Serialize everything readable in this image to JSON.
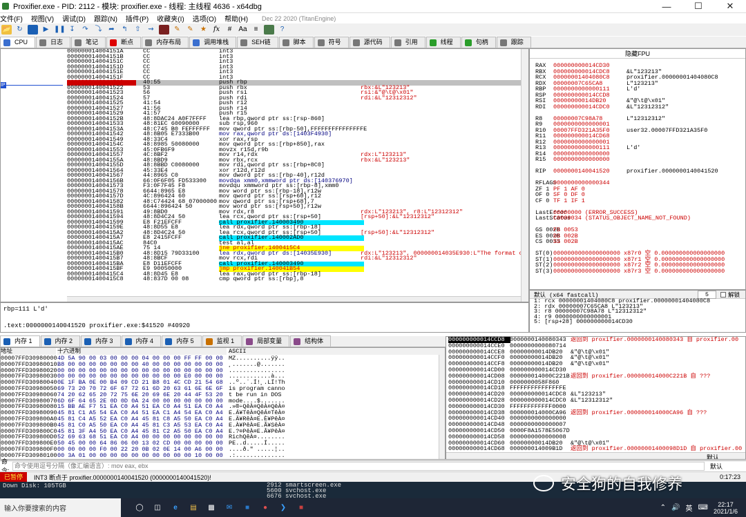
{
  "window": {
    "title": "Proxifier.exe - PID: 2112 - 模块: proxifier.exe - 线程: 主线程 4636 - x64dbg"
  },
  "menu": {
    "items": [
      "文件(F)",
      "视图(V)",
      "调试(D)",
      "跟踪(N)",
      "插件(P)",
      "收藏夹(I)",
      "选项(O)",
      "帮助(H)"
    ],
    "date": "Dec 22 2020 (TitanEngine)"
  },
  "toolbar": {
    "icons": [
      "open-icon",
      "restart-icon",
      "stop-icon",
      "run-icon",
      "pause-icon",
      "step-into-icon",
      "step-over-icon",
      "trace-into-icon",
      "trace-over-icon",
      "execute-till-return-icon",
      "run-to-user-code-icon",
      "scylla-icon",
      "patch-icon",
      "comment-icon",
      "label-icon",
      "bookmark-icon",
      "function-icon",
      "hash-icon",
      "font-icon",
      "strings-icon",
      "calculator-icon",
      "help-icon"
    ]
  },
  "tabs": [
    {
      "label": "CPU",
      "color": "#3a6fcf",
      "active": true
    },
    {
      "label": "日志",
      "color": "#777"
    },
    {
      "label": "笔记",
      "color": "#777"
    },
    {
      "label": "断点",
      "color": "#d00"
    },
    {
      "label": "内存布局",
      "color": "#777"
    },
    {
      "label": "调用堆栈",
      "color": "#3a6fcf"
    },
    {
      "label": "SEH链",
      "color": "#777"
    },
    {
      "label": "脚本",
      "color": "#777"
    },
    {
      "label": "符号",
      "color": "#777"
    },
    {
      "label": "源代码",
      "color": "#777"
    },
    {
      "label": "引用",
      "color": "#777"
    },
    {
      "label": "线程",
      "color": "#2a9d2a"
    },
    {
      "label": "句柄",
      "color": "#2a9d2a"
    },
    {
      "label": "跟踪",
      "color": "#777"
    }
  ],
  "disasm": [
    {
      "addr": "000000014004151A",
      "bytes": "CC",
      "asm": "int3",
      "cmt": ""
    },
    {
      "addr": "000000014004151B",
      "bytes": "CC",
      "asm": "int3",
      "cmt": ""
    },
    {
      "addr": "000000014004151C",
      "bytes": "CC",
      "asm": "int3",
      "cmt": ""
    },
    {
      "addr": "000000014004151D",
      "bytes": "CC",
      "asm": "int3",
      "cmt": ""
    },
    {
      "addr": "000000014004151E",
      "bytes": "CC",
      "asm": "int3",
      "cmt": ""
    },
    {
      "addr": "000000014004151F",
      "bytes": "CC",
      "asm": "int3",
      "cmt": ""
    },
    {
      "addr": "0000000140041520",
      "bytes": "40:55",
      "asm": "push rbp",
      "cmt": "",
      "sel": true
    },
    {
      "addr": "0000000140041522",
      "bytes": "53",
      "asm": "push rbx",
      "cmt": "rbx:&L\"123213\""
    },
    {
      "addr": "0000000140041523",
      "bytes": "56",
      "asm": "push rsi",
      "cmt": "rsi:&\"@\\t@\\x01\""
    },
    {
      "addr": "0000000140041524",
      "bytes": "57",
      "asm": "push rdi",
      "cmt": "rdi:&L\"12312312\""
    },
    {
      "addr": "0000000140041525",
      "bytes": "41:54",
      "asm": "push r12",
      "cmt": ""
    },
    {
      "addr": "0000000140041527",
      "bytes": "41:56",
      "asm": "push r14",
      "cmt": ""
    },
    {
      "addr": "0000000140041529",
      "bytes": "41:57",
      "asm": "push r15",
      "cmt": ""
    },
    {
      "addr": "000000014004152B",
      "bytes": "48:8DAC24 A0F7FFFF",
      "asm": "lea rbp,qword ptr ss:[rsp-860]",
      "cmt": ""
    },
    {
      "addr": "0000000140041533",
      "bytes": "48:81EC 60090000",
      "asm": "sub rsp,960",
      "cmt": ""
    },
    {
      "addr": "000000014004153A",
      "bytes": "48:C745 B0 FEFFFFFF",
      "asm": "mov qword ptr ss:[rbp-50],FFFFFFFFFFFFFFFE",
      "cmt": ""
    },
    {
      "addr": "0000000140041542",
      "bytes": "48:8B05 E7333B00",
      "asm": "mov rax,qword ptr ds:[1403F4930]",
      "cmt": "",
      "hl": "1403F4930"
    },
    {
      "addr": "0000000140041549",
      "bytes": "48:33C4",
      "asm": "xor rax,rsp",
      "cmt": ""
    },
    {
      "addr": "000000014004154C",
      "bytes": "48:8985 50080000",
      "asm": "mov qword ptr ss:[rbp+850],rax",
      "cmt": ""
    },
    {
      "addr": "0000000140041553",
      "bytes": "45:0FB6F9",
      "asm": "movzx r15d,r9b",
      "cmt": ""
    },
    {
      "addr": "0000000140041557",
      "bytes": "4C:8BF2",
      "asm": "mov r14,rdx",
      "cmt": "rdx:L\"123213\""
    },
    {
      "addr": "000000014004155A",
      "bytes": "48:8BD9",
      "asm": "mov rbx,rcx",
      "cmt": "rbx:&L\"123213\""
    },
    {
      "addr": "000000014004155D",
      "bytes": "48:8BBD C0080000",
      "asm": "mov rdi,qword ptr ss:[rbp+8C0]",
      "cmt": ""
    },
    {
      "addr": "0000000140041564",
      "bytes": "45:33E4",
      "asm": "xor r12d,r12d",
      "cmt": ""
    },
    {
      "addr": "0000000140041567",
      "bytes": "44:8965 C0",
      "asm": "mov dword ptr ss:[rbp-40],r12d",
      "cmt": ""
    },
    {
      "addr": "000000014004156B",
      "bytes": "66:0F6F05 FD533300",
      "asm": "movdqa xmm0,xmmword ptr ds:[140376970]",
      "cmt": "",
      "hl": "140376970"
    },
    {
      "addr": "0000000140041573",
      "bytes": "F3:0F7F45 F8",
      "asm": "movdqu xmmword ptr ss:[rbp-8],xmm0",
      "cmt": ""
    },
    {
      "addr": "0000000140041578",
      "bytes": "6644:8965 E8",
      "asm": "mov word ptr ss:[rbp-18],r12w",
      "cmt": ""
    },
    {
      "addr": "000000014004157D",
      "bytes": "4C:896424 60",
      "asm": "mov qword ptr ss:[rsp+60],r12",
      "cmt": ""
    },
    {
      "addr": "0000000140041582",
      "bytes": "48:C74424 68 07000000",
      "asm": "mov qword ptr ss:[rsp+68],7",
      "cmt": ""
    },
    {
      "addr": "000000014004158B",
      "bytes": "6644:896424 50",
      "asm": "mov word ptr ss:[rsp+50],r12w",
      "cmt": ""
    },
    {
      "addr": "0000000140041591",
      "bytes": "49:8BD0",
      "asm": "mov rdx,r8",
      "cmt": "rdx:L\"123213\", r8:L\"12312312\""
    },
    {
      "addr": "0000000140041594",
      "bytes": "48:8D4C24 50",
      "asm": "lea rcx,qword ptr ss:[rsp+50]",
      "cmt": "[rsp+50]:&L\"12312312\""
    },
    {
      "addr": "0000000140041599",
      "bytes": "E8 F21EFCFF",
      "asm": "call proxifier.140003490",
      "cmt": "",
      "call": true
    },
    {
      "addr": "000000014004159E",
      "bytes": "48:8D55 E8",
      "asm": "lea rdx,qword ptr ss:[rbp-18]",
      "cmt": ""
    },
    {
      "addr": "00000001400415A2",
      "bytes": "48:8D4C24 50",
      "asm": "lea rcx,qword ptr ss:[rsp+50]",
      "cmt": "[rsp+50]:&L\"12312312\""
    },
    {
      "addr": "00000001400415A7",
      "bytes": "E8 2415FCFF",
      "asm": "call proxifier.140002AD0",
      "cmt": "",
      "call": true
    },
    {
      "addr": "00000001400415AC",
      "bytes": "84C0",
      "asm": "test al,al",
      "cmt": ""
    },
    {
      "addr": "00000001400415AE",
      "bytes": "75 14",
      "asm": "jne proxifier.1400415C4",
      "cmt": "",
      "jmp": true
    },
    {
      "addr": "00000001400415B0",
      "bytes": "48:8D15 79D33100",
      "asm": "lea rdx,qword ptr ds:[14035E930]",
      "cmt": "rdx:L\"123213\", 000000014035E930:L\"The format of",
      "hl": "14035E930"
    },
    {
      "addr": "00000001400415B7",
      "bytes": "48:8BCF",
      "asm": "mov rcx,rdi",
      "cmt": "rdi:&L\"12312312\""
    },
    {
      "addr": "00000001400415BA",
      "bytes": "E8 D11EFCFF",
      "asm": "call proxifier.140003490",
      "cmt": "",
      "call": true
    },
    {
      "addr": "00000001400415BF",
      "bytes": "E9 90050000",
      "asm": "jmp proxifier.140041B54",
      "cmt": "",
      "jmp": true
    },
    {
      "addr": "00000001400415C4",
      "bytes": "48:8D45 E8",
      "asm": "lea rax,qword ptr ss:[rbp-18]",
      "cmt": ""
    },
    {
      "addr": "00000001400415C8",
      "bytes": "48:837D 00 08",
      "asm": "cmp qword ptr ss:[rbp],8",
      "cmt": ""
    }
  ],
  "registers": {
    "header": "隐藏FPU",
    "gp": [
      {
        "n": "RAX",
        "v": "000000000014CD30",
        "c": ""
      },
      {
        "n": "RBX",
        "v": "000000000014CDC8",
        "c": "&L\"123213\""
      },
      {
        "n": "RCX",
        "v": "00000001404080C8",
        "c": "proxifier.00000001404080C8"
      },
      {
        "n": "RDX",
        "v": "00000007C65CA8",
        "c": "L\"123213\""
      },
      {
        "n": "RBP",
        "v": "0000000000000111",
        "c": "L'd'"
      },
      {
        "n": "RSP",
        "v": "000000000014CCD8",
        "c": ""
      },
      {
        "n": "RSI",
        "v": "00000000014DB20",
        "c": "&\"@\\t@\\x01\""
      },
      {
        "n": "RDI",
        "v": "000000000014CDC0",
        "c": "&L\"12312312\""
      },
      {
        "n": "",
        "v": "",
        "c": ""
      },
      {
        "n": "R8",
        "v": "00000007C98A78",
        "c": "L\"12312312\""
      },
      {
        "n": "R9",
        "v": "0000000000000001",
        "c": ""
      },
      {
        "n": "R10",
        "v": "00007FFD321A35F0",
        "c": "user32.00007FFD321A35F0"
      },
      {
        "n": "R11",
        "v": "000000000014CD68",
        "c": ""
      },
      {
        "n": "R12",
        "v": "0000000000000001",
        "c": ""
      },
      {
        "n": "R13",
        "v": "0000000000000111",
        "c": "L'd'"
      },
      {
        "n": "R14",
        "v": "0000000000000000",
        "c": ""
      },
      {
        "n": "R15",
        "v": "0000000000000000",
        "c": ""
      },
      {
        "n": "",
        "v": "",
        "c": ""
      },
      {
        "n": "RIP",
        "v": "0000000140041520",
        "c": "proxifier.0000000140041520"
      },
      {
        "n": "",
        "v": "",
        "c": ""
      },
      {
        "n": "RFLAGS",
        "v": "0000000000000344",
        "c": ""
      },
      {
        "n": "ZF 1",
        "v": "PF 1  AF 0",
        "c": ""
      },
      {
        "n": "OF 0",
        "v": "SF 0  DF 0",
        "c": ""
      },
      {
        "n": "CF 0",
        "v": "TF 1  IF 1",
        "c": ""
      },
      {
        "n": "",
        "v": "",
        "c": ""
      },
      {
        "n": "LastError",
        "v": "00000000 (ERROR_SUCCESS)",
        "c": ""
      },
      {
        "n": "LastStatus",
        "v": "C0000034 (STATUS_OBJECT_NAME_NOT_FOUND)",
        "c": ""
      },
      {
        "n": "",
        "v": "",
        "c": ""
      },
      {
        "n": "GS 002B",
        "v": "FS 0053",
        "c": ""
      },
      {
        "n": "ES 002B",
        "v": "DS 002B",
        "c": ""
      },
      {
        "n": "CS 0033",
        "v": "SS 002B",
        "c": ""
      },
      {
        "n": "",
        "v": "",
        "c": ""
      },
      {
        "n": "ST(0)",
        "v": "0000000000000000000 x87r0 空 0.000000000000000000",
        "c": ""
      },
      {
        "n": "ST(1)",
        "v": "0000000000000000000 x87r1 空 0.000000000000000000",
        "c": ""
      },
      {
        "n": "ST(2)",
        "v": "0000000000000000000 x87r2 空 0.000000000000000000",
        "c": ""
      },
      {
        "n": "ST(3)",
        "v": "0000000000000000000 x87r3 空 0.000000000000000000",
        "c": ""
      }
    ]
  },
  "callconv": {
    "label": "默认 (x64 fastcall)",
    "count": "5",
    "unlock": "解锁",
    "lines": [
      "1: rcx 00000001404080C8 proxifier.00000001404080C8",
      "2: rdx 00000007C65CA8 L\"123213\"",
      "3: r8 00000007C98A78 L\"12312312\"",
      "4: r9 0000000000000001",
      "5: [rsp+28] 000000000014CD30"
    ]
  },
  "info": {
    "line1": "rbp=111 L'd'",
    "line2": "",
    "line3": ".text:0000000140041520 proxifier.exe:$41520 #40920"
  },
  "memtabs": [
    "内存 1",
    "内存 2",
    "内存 3",
    "内存 4",
    "内存 5",
    "监视 1",
    "局部变量",
    "结构体"
  ],
  "dump": {
    "hdr_hex": "十六进制",
    "hdr_ascii": "ASCII",
    "rows": [
      {
        "a": "00007FFD30980000",
        "h": "4D 5A 90 00 03 00 00 00 04 00 00 00 FF FF 00 00",
        "c": "MZ..........ÿÿ.."
      },
      {
        "a": "00007FFD30980010",
        "h": "B8 00 00 00 00 00 00 00 40 00 00 00 00 00 00 00",
        "c": "¸.......@......."
      },
      {
        "a": "00007FFD30980020",
        "h": "00 00 00 00 00 00 00 00 00 00 00 00 00 00 00 00",
        "c": "................"
      },
      {
        "a": "00007FFD30980030",
        "h": "00 00 00 00 00 00 00 00 00 00 00 00 E0 00 00 00",
        "c": "............à..."
      },
      {
        "a": "00007FFD30980040",
        "h": "0E 1F BA 0E 00 B4 09 CD 21 B8 01 4C CD 21 54 68",
        "c": "..º..´.Í!¸.LÍ!Th"
      },
      {
        "a": "00007FFD30980050",
        "h": "69 73 20 70 72 6F 67 72 61 6D 20 63 61 6E 6E 6F",
        "c": "is program canno"
      },
      {
        "a": "00007FFD30980060",
        "h": "74 20 62 65 20 72 75 6E 20 69 6E 20 44 4F 53 20",
        "c": "t be run in DOS "
      },
      {
        "a": "00007FFD30980070",
        "h": "6D 6F 64 65 2E 0D 0D 0A 24 00 00 00 00 00 00 00",
        "c": "mode....$......."
      },
      {
        "a": "00007FFD30980080",
        "h": "15 BB AE F7 51 EA C0 A4 51 EA C0 A4 51 EA C0 A4",
        "c": ".»®÷QêÀ¤QêÀ¤QêÀ¤"
      },
      {
        "a": "00007FFD30980090",
        "h": "45 81 C1 A5 54 EA C0 A4 51 EA C1 A4 54 EA C0 A4",
        "c": "E.Á¥TêÀ¤QêÁ¤TêÀ¤"
      },
      {
        "a": "00007FFD309800A0",
        "h": "45 81 C4 A5 52 EA C0 A4 45 81 C8 A5 50 EA C0 A4",
        "c": "E.Ä¥RêÀ¤E.È¥PêÀ¤"
      },
      {
        "a": "00007FFD309800B0",
        "h": "45 81 C0 A5 50 EA C0 A4 45 81 C3 A5 53 EA C0 A4",
        "c": "E.À¥PêÀ¤E.Ã¥SêÀ¤"
      },
      {
        "a": "00007FFD309800C0",
        "h": "45 81 3F A4 50 EA C0 A4 45 81 C2 A5 50 EA C0 A4",
        "c": "E.?¤PêÀ¤E.Â¥PêÀ¤"
      },
      {
        "a": "00007FFD309800D0",
        "h": "52 69 63 68 51 EA C0 A4 00 00 00 00 00 00 00 00",
        "c": "RichQêÀ¤........"
      },
      {
        "a": "00007FFD309800E0",
        "h": "50 45 00 00 64 86 06 00 13 02 CD 00 00 00 00 00",
        "c": "PE..d.....Í....."
      },
      {
        "a": "00007FFD309800F0",
        "h": "00 00 00 00 F0 00 22 20 0B 02 0E 14 00 A6 00 00",
        "c": "....ð.\" .....¦.."
      },
      {
        "a": "00007FFD30980100",
        "h": "00 3A 01 00 00 00 00 00 00 00 00 00 00 10 00 00",
        "c": ".:.............."
      },
      {
        "a": "00007FFD30980110",
        "h": "00 00 98 30 FD 7F 00 00 00 10 00 00 00 00 00 00",
        "c": "...0ý..........."
      }
    ]
  },
  "stack": [
    {
      "a": "000000000014CCD8",
      "v": "0000000140080343",
      "c": "返回到 proxifier.0000000140080343 自 proxifier.00",
      "top": true,
      "red": true
    },
    {
      "a": "000000000014CCE0",
      "v": "0000000000080714",
      "c": ""
    },
    {
      "a": "000000000014CCE8",
      "v": "00000000014DB20",
      "c": "&\"@\\t@\\x01\""
    },
    {
      "a": "000000000014CCF0",
      "v": "00000000014DB20",
      "c": "&\"@\\t@\\x01\""
    },
    {
      "a": "000000000014CCF8",
      "v": "00000000014DB20",
      "c": "&\"@\\t@\\x01\""
    },
    {
      "a": "000000000014CD00",
      "v": "000000000014CD30",
      "c": ""
    },
    {
      "a": "000000000014CD08",
      "v": "000000014000C221B",
      "c": "返回到 proxifier.000000014000C221B 自 ???",
      "red": true
    },
    {
      "a": "000000000014CD10",
      "v": "0000000058F860",
      "c": ""
    },
    {
      "a": "000000000014CD18",
      "v": "FFFFFFFFFFFFFFFE",
      "c": ""
    },
    {
      "a": "000000000014CD20",
      "v": "000000000014CDC8",
      "c": "&L\"123213\""
    },
    {
      "a": "000000000014CD28",
      "v": "000000000014CDC0",
      "c": "&L\"12312312\""
    },
    {
      "a": "000000000014CD30",
      "v": "FFFFFFFFFFFF0000",
      "c": ""
    },
    {
      "a": "000000000014CD38",
      "v": "000000014000CA96",
      "c": "返回到 proxifier.000000014000CA96 自 ???",
      "red": true
    },
    {
      "a": "000000000014CD40",
      "v": "0000000000000000",
      "c": ""
    },
    {
      "a": "000000000014CD48",
      "v": "0000000000000007",
      "c": ""
    },
    {
      "a": "000000000014CD50",
      "v": "0000F8A1578E5067D",
      "c": ""
    },
    {
      "a": "000000000014CD58",
      "v": "0000000000000008",
      "c": ""
    },
    {
      "a": "000000000014CD60",
      "v": "00000000014DB20",
      "c": "&\"@\\t@\\x01\""
    },
    {
      "a": "000000000014CD68",
      "v": "000000014009B1D",
      "c": "返回到 proxifier.00000001400098D1D 自 proxifier.00",
      "red": true
    },
    {
      "a": "000000000014CD70",
      "v": "0000000000000001",
      "c": ""
    }
  ],
  "stackfoot": "默认",
  "cmd": {
    "label": "命令:",
    "placeholder": "命令使用逗号分隔（像汇编语言）: mov eax, ebx",
    "right": "默认"
  },
  "status": {
    "paused": "已暂停",
    "msg": "INT3 断点于 proxifier.0000000140041520 (0000000140041520)!",
    "time": "0:17:23"
  },
  "behind": {
    "left": "Down  Disk: 105TGB",
    "l1": "2912   smartscreen.exe",
    "l2": "5600   svchost.exe",
    "l3": "6676   svchost.exe"
  },
  "taskbar": {
    "search": "输入你要搜索的内容",
    "time": "22:17",
    "date": "2021/1/6",
    "lang": "英"
  },
  "watermark": {
    "text": "安全狗的自我修养"
  }
}
